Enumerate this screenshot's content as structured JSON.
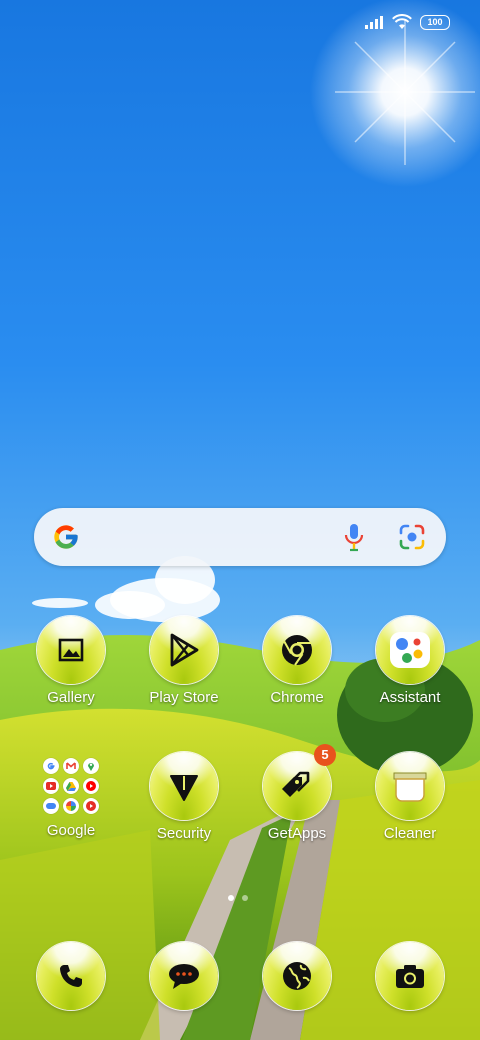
{
  "status_bar": {
    "signal_icon": "signal-bars-icon",
    "wifi_icon": "wifi-icon",
    "battery_level": "100"
  },
  "search_widget": {
    "logo_icon": "google-g-icon",
    "voice_icon": "mic-icon",
    "lens_icon": "lens-camera-icon"
  },
  "apps": [
    {
      "label": "Gallery",
      "icon": "gallery-icon"
    },
    {
      "label": "Play Store",
      "icon": "play-store-icon"
    },
    {
      "label": "Chrome",
      "icon": "chrome-icon"
    },
    {
      "label": "Assistant",
      "icon": "assistant-icon"
    },
    {
      "label": "Google",
      "icon": "google-folder-icon"
    },
    {
      "label": "Security",
      "icon": "security-icon"
    },
    {
      "label": "GetApps",
      "icon": "getapps-icon",
      "badge": "5"
    },
    {
      "label": "Cleaner",
      "icon": "cleaner-icon"
    }
  ],
  "dock": [
    {
      "icon": "phone-icon"
    },
    {
      "icon": "messages-icon"
    },
    {
      "icon": "browser-globe-icon"
    },
    {
      "icon": "camera-icon"
    }
  ],
  "page_indicator": {
    "pages": 2,
    "active": 1
  },
  "colors": {
    "sky": "#1e7fe6",
    "grass": "#8ccf2c",
    "badge": "#e8531d"
  }
}
